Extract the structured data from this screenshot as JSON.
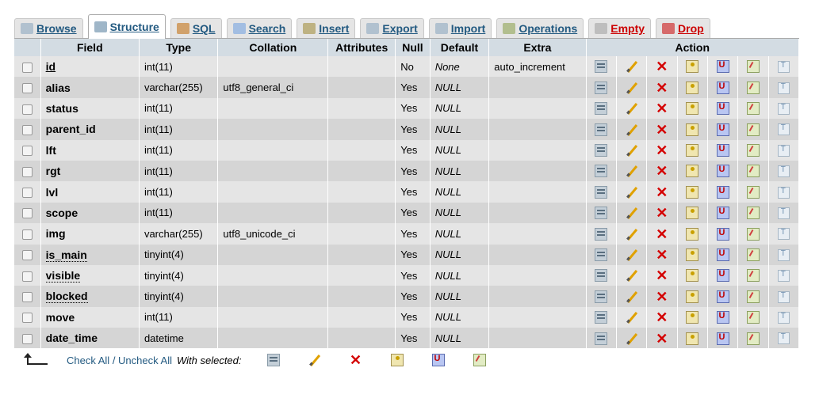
{
  "tabs": [
    {
      "label": "Browse",
      "icon": "browse-icon",
      "active": false
    },
    {
      "label": "Structure",
      "icon": "structure-icon",
      "active": true
    },
    {
      "label": "SQL",
      "icon": "sql-icon",
      "active": false
    },
    {
      "label": "Search",
      "icon": "search-icon",
      "active": false
    },
    {
      "label": "Insert",
      "icon": "insert-icon",
      "active": false
    },
    {
      "label": "Export",
      "icon": "export-icon",
      "active": false
    },
    {
      "label": "Import",
      "icon": "import-icon",
      "active": false
    },
    {
      "label": "Operations",
      "icon": "operations-icon",
      "active": false
    },
    {
      "label": "Empty",
      "icon": "empty-icon",
      "active": false
    },
    {
      "label": "Drop",
      "icon": "drop-icon",
      "active": false
    }
  ],
  "columns": {
    "field": "Field",
    "type": "Type",
    "collation": "Collation",
    "attributes": "Attributes",
    "null": "Null",
    "default": "Default",
    "extra": "Extra",
    "action": "Action"
  },
  "rows": [
    {
      "field": "id",
      "type": "int(11)",
      "collation": "",
      "attributes": "",
      "null": "No",
      "default": "None",
      "extra": "auto_increment"
    },
    {
      "field": "alias",
      "type": "varchar(255)",
      "collation": "utf8_general_ci",
      "attributes": "",
      "null": "Yes",
      "default": "NULL",
      "extra": ""
    },
    {
      "field": "status",
      "type": "int(11)",
      "collation": "",
      "attributes": "",
      "null": "Yes",
      "default": "NULL",
      "extra": ""
    },
    {
      "field": "parent_id",
      "type": "int(11)",
      "collation": "",
      "attributes": "",
      "null": "Yes",
      "default": "NULL",
      "extra": ""
    },
    {
      "field": "lft",
      "type": "int(11)",
      "collation": "",
      "attributes": "",
      "null": "Yes",
      "default": "NULL",
      "extra": ""
    },
    {
      "field": "rgt",
      "type": "int(11)",
      "collation": "",
      "attributes": "",
      "null": "Yes",
      "default": "NULL",
      "extra": ""
    },
    {
      "field": "lvl",
      "type": "int(11)",
      "collation": "",
      "attributes": "",
      "null": "Yes",
      "default": "NULL",
      "extra": ""
    },
    {
      "field": "scope",
      "type": "int(11)",
      "collation": "",
      "attributes": "",
      "null": "Yes",
      "default": "NULL",
      "extra": ""
    },
    {
      "field": "img",
      "type": "varchar(255)",
      "collation": "utf8_unicode_ci",
      "attributes": "",
      "null": "Yes",
      "default": "NULL",
      "extra": ""
    },
    {
      "field": "is_main",
      "type": "tinyint(4)",
      "collation": "",
      "attributes": "",
      "null": "Yes",
      "default": "NULL",
      "extra": ""
    },
    {
      "field": "visible",
      "type": "tinyint(4)",
      "collation": "",
      "attributes": "",
      "null": "Yes",
      "default": "NULL",
      "extra": ""
    },
    {
      "field": "blocked",
      "type": "tinyint(4)",
      "collation": "",
      "attributes": "",
      "null": "Yes",
      "default": "NULL",
      "extra": ""
    },
    {
      "field": "move",
      "type": "int(11)",
      "collation": "",
      "attributes": "",
      "null": "Yes",
      "default": "NULL",
      "extra": ""
    },
    {
      "field": "date_time",
      "type": "datetime",
      "collation": "",
      "attributes": "",
      "null": "Yes",
      "default": "NULL",
      "extra": ""
    }
  ],
  "row_actions": [
    "browse-icon",
    "edit-icon",
    "drop-icon",
    "primary-key-icon",
    "unique-icon",
    "index-icon",
    "fulltext-icon"
  ],
  "footer": {
    "check_all": "Check All",
    "separator": " / ",
    "uncheck_all": "Uncheck All",
    "with_selected": "With selected:",
    "actions": [
      "browse-icon",
      "edit-icon",
      "drop-icon",
      "primary-key-icon",
      "unique-icon",
      "index-icon"
    ]
  },
  "colors": {
    "link": "#235a81",
    "header_bg": "#d3dce3",
    "row_odd": "#e5e5e5",
    "row_even": "#d5d5d5",
    "danger": "#cc0000"
  }
}
